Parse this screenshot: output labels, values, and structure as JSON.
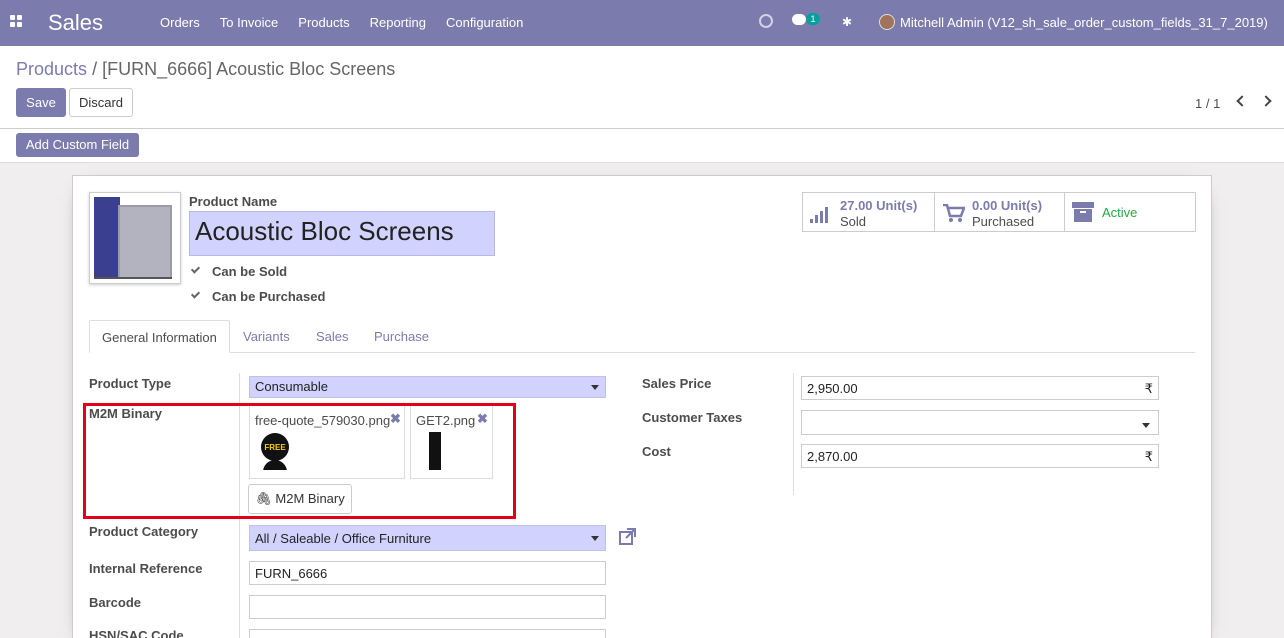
{
  "navbar": {
    "brand": "Sales",
    "menu": [
      "Orders",
      "To Invoice",
      "Products",
      "Reporting",
      "Configuration"
    ],
    "chat_count": "1",
    "user": "Mitchell Admin (V12_sh_sale_order_custom_fields_31_7_2019)",
    "color": "#7c7bad"
  },
  "control": {
    "breadcrumb_parent": "Products",
    "breadcrumb_sep": "/",
    "breadcrumb_current": "[FURN_6666] Acoustic Bloc Screens",
    "save_label": "Save",
    "discard_label": "Discard",
    "pager": "1 / 1",
    "add_custom_field": "Add Custom Field"
  },
  "product": {
    "name_label": "Product Name",
    "name": "Acoustic Bloc Screens",
    "can_be_sold": "Can be Sold",
    "can_be_purchased": "Can be Purchased"
  },
  "stats": {
    "sold_value": "27.00 Unit(s)",
    "sold_label": "Sold",
    "purchased_value": "0.00 Unit(s)",
    "purchased_label": "Purchased",
    "active_label": "Active"
  },
  "tabs": [
    "General Information",
    "Variants",
    "Sales",
    "Purchase"
  ],
  "general": {
    "product_type_label": "Product Type",
    "product_type": "Consumable",
    "m2m_label": "M2M Binary",
    "attachments": [
      {
        "name": "free-quote_579030.png",
        "icon": "free-quote-thumbnail"
      },
      {
        "name": "GET2.png",
        "icon": "get2-thumbnail"
      }
    ],
    "m2m_button": "M2M Binary",
    "category_label": "Product Category",
    "category": "All / Saleable / Office Furniture",
    "internal_ref_label": "Internal Reference",
    "internal_ref": "FURN_6666",
    "barcode_label": "Barcode",
    "barcode": "",
    "hsn_label": "HSN/SAC Code",
    "sales_price_label": "Sales Price",
    "sales_price": "2,950.00",
    "customer_taxes_label": "Customer Taxes",
    "customer_taxes": "",
    "cost_label": "Cost",
    "cost": "2,870.00",
    "currency": "₹"
  }
}
